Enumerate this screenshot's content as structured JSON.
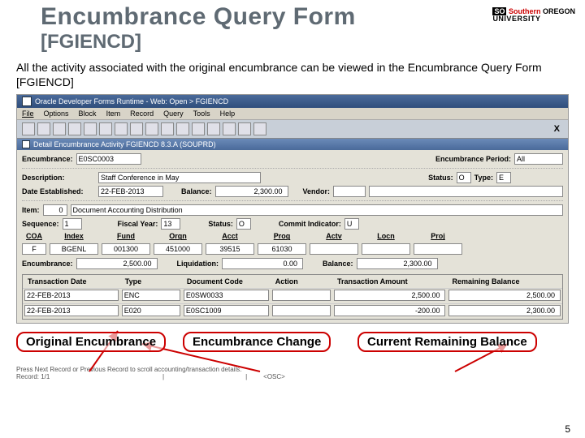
{
  "title": {
    "main": "Encumbrance Query Form",
    "code": "[FGIENCD]"
  },
  "logo": {
    "so": "SO",
    "southern": "Southern",
    "oregon": "OREGON",
    "univ": "UNIVERSITY"
  },
  "desc": "All the activity associated with the original encumbrance can be viewed in the Encumbrance Query Form [FGIENCD]",
  "app": {
    "window_title": "Oracle Developer Forms Runtime - Web: Open > FGIENCD",
    "menu": [
      "File",
      "Options",
      "Block",
      "Item",
      "Record",
      "Query",
      "Tools",
      "Help"
    ],
    "close_x": "X",
    "section_title": "Detail Encumbrance Activity  FGIENCD  8.3.A  (SOUPRD)"
  },
  "header_form": {
    "encumbrance_lbl": "Encumbrance:",
    "encumbrance": "E0SC0003",
    "encperiod_lbl": "Encumbrance Period:",
    "encperiod": "All",
    "description_lbl": "Description:",
    "description": "Staff Conference in May",
    "status_lbl": "Status:",
    "status": "O",
    "type_lbl": "Type:",
    "type": "E",
    "date_lbl": "Date Established:",
    "date": "22-FEB-2013",
    "balance_lbl": "Balance:",
    "balance": "2,300.00",
    "vendor_lbl": "Vendor:",
    "vendor": ""
  },
  "detail": {
    "item_lbl": "Item:",
    "item": "0",
    "item_desc": "Document Accounting Distribution",
    "sequence_lbl": "Sequence:",
    "sequence": "1",
    "fy_lbl": "Fiscal Year:",
    "fy": "13",
    "status_lbl": "Status:",
    "status": "O",
    "commit_lbl": "Commit Indicator:",
    "commit": "U",
    "cols": [
      "COA",
      "Index",
      "Fund",
      "Orgn",
      "Acct",
      "Prog",
      "Actv",
      "Locn",
      "Proj"
    ],
    "vals": [
      "F",
      "BGENL",
      "001300",
      "451000",
      "39515",
      "61030",
      "",
      "",
      ""
    ],
    "enc_lbl": "Encumbrance:",
    "enc": "2,500.00",
    "liq_lbl": "Liquidation:",
    "liq": "0.00",
    "bal_lbl": "Balance:",
    "bal": "2,300.00"
  },
  "table": {
    "headers": [
      "Transaction Date",
      "Type",
      "Document Code",
      "Action",
      "Transaction Amount",
      "Remaining Balance"
    ],
    "rows": [
      {
        "date": "22-FEB-2013",
        "type": "ENC",
        "doc": "E0SW0033",
        "action": "",
        "amt": "2,500.00",
        "bal": "2,500.00"
      },
      {
        "date": "22-FEB-2013",
        "type": "E020",
        "doc": "E0SC1009",
        "action": "",
        "amt": "-200.00",
        "bal": "2,300.00"
      }
    ]
  },
  "annotations": {
    "orig": "Original Encumbrance",
    "change": "Encumbrance Change",
    "balance": "Current Remaining Balance"
  },
  "status": {
    "hint": "Press Next Record or Previous Record to scroll accounting/transaction details.",
    "record": "Record: 1/1",
    "osc": "<OSC>"
  },
  "pagenum": "5"
}
